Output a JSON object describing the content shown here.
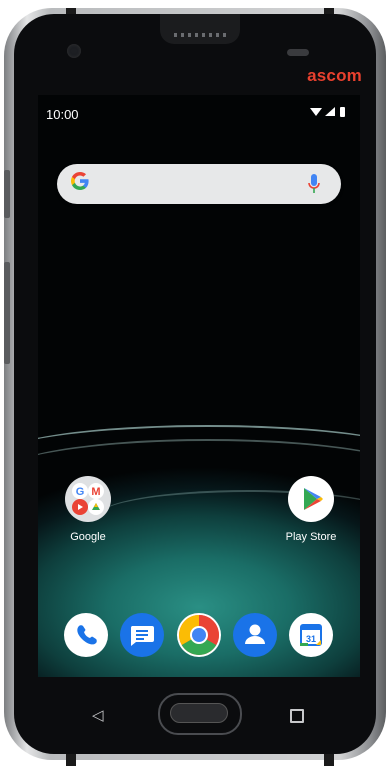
{
  "device": {
    "brand": "ascom"
  },
  "status_bar": {
    "time": "10:00",
    "icons": "▼◢▮"
  },
  "search_bar": {
    "logo": "G"
  },
  "home_apps": [
    {
      "label": "Google",
      "icon": "google-folder-icon"
    },
    {
      "label": "Play Store",
      "icon": "play-store-icon"
    }
  ],
  "dock": [
    {
      "name": "Phone",
      "icon": "phone-icon",
      "color": "#1a73e8"
    },
    {
      "name": "Messages",
      "icon": "messages-icon",
      "color": "#1a73e8"
    },
    {
      "name": "Chrome",
      "icon": "chrome-icon",
      "color": "#4285f4"
    },
    {
      "name": "Contacts",
      "icon": "contacts-icon",
      "color": "#1a73e8"
    },
    {
      "name": "Calendar",
      "icon": "calendar-icon",
      "color": "#1a73e8",
      "day": "31"
    }
  ],
  "nav": {
    "back": "◁",
    "recent": "□"
  },
  "colors": {
    "brand": "#e8402e",
    "google_blue": "#4285f4",
    "google_red": "#ea4335",
    "google_yellow": "#fbbc05",
    "google_green": "#34a853"
  }
}
